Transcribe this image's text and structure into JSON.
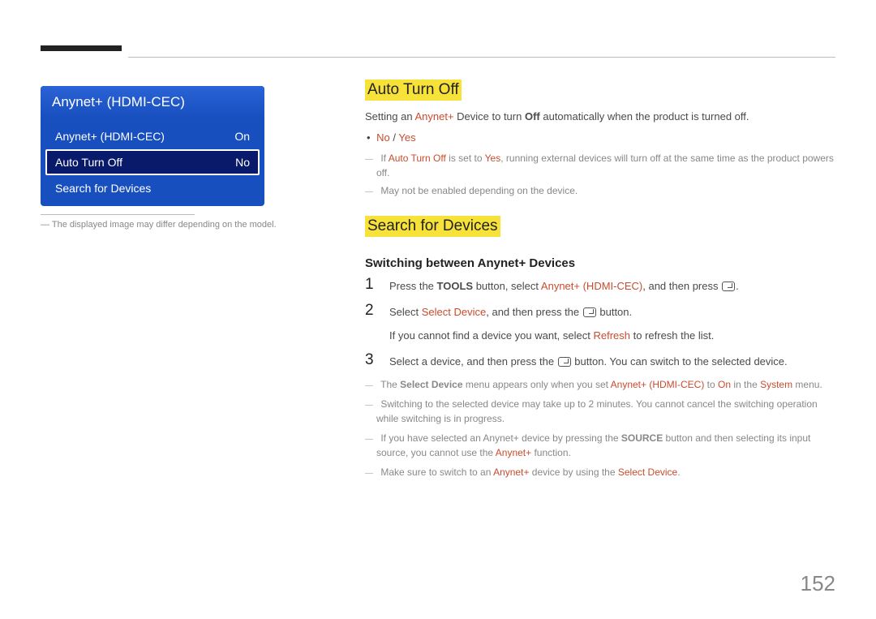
{
  "menu": {
    "title": "Anynet+ (HDMI-CEC)",
    "items": [
      {
        "label": "Anynet+ (HDMI-CEC)",
        "value": "On"
      },
      {
        "label": "Auto Turn Off",
        "value": "No"
      },
      {
        "label": "Search for Devices",
        "value": ""
      }
    ],
    "note": "The displayed image may differ depending on the model."
  },
  "section1": {
    "title": "Auto Turn Off",
    "desc_pre": "Setting an ",
    "desc_red1": "Anynet+",
    "desc_mid1": " Device to turn ",
    "desc_bold1": "Off",
    "desc_post1": " automatically when the product is turned off.",
    "opt_no": "No",
    "opt_sep": " / ",
    "opt_yes": "Yes",
    "note1_pre": "If ",
    "note1_red": "Auto Turn Off",
    "note1_mid": " is set to ",
    "note1_red2": "Yes",
    "note1_post": ", running external devices will turn off at the same time as the product powers off.",
    "note2": "May not be enabled depending on the device."
  },
  "section2": {
    "title": "Search for Devices",
    "subheading": "Switching between Anynet+ Devices",
    "steps": {
      "s1_pre": "Press the ",
      "s1_b1": "TOOLS",
      "s1_mid1": " button, select ",
      "s1_red1": "Anynet+ (HDMI-CEC)",
      "s1_mid2": ", and then press ",
      "s2_pre": "Select ",
      "s2_red1": "Select Device",
      "s2_mid1": ", and then press the ",
      "s2_post": " button.",
      "s2_note_pre": "If you cannot find a device you want, select ",
      "s2_note_red": "Refresh",
      "s2_note_post": " to refresh the list.",
      "s3_pre": "Select a device, and then press the ",
      "s3_post": " button. You can switch to the selected device."
    },
    "notes": {
      "n1_pre": "The ",
      "n1_b1": "Select Device",
      "n1_mid1": " menu appears only when you set ",
      "n1_red1": "Anynet+ (HDMI-CEC)",
      "n1_mid2": " to ",
      "n1_red2": "On",
      "n1_mid3": " in the ",
      "n1_red3": "System",
      "n1_post": " menu.",
      "n2": "Switching to the selected device may take up to 2 minutes. You cannot cancel the switching operation while switching is in progress.",
      "n3_pre": "If you have selected an Anynet+ device by pressing the ",
      "n3_b1": "SOURCE",
      "n3_mid": " button and then selecting its input source, you cannot use the ",
      "n3_red": "Anynet+",
      "n3_post": " function.",
      "n4_pre": "Make sure to switch to an ",
      "n4_red1": "Anynet+",
      "n4_mid": " device by using the ",
      "n4_red2": "Select Device",
      "n4_post": "."
    }
  },
  "page_number": "152"
}
